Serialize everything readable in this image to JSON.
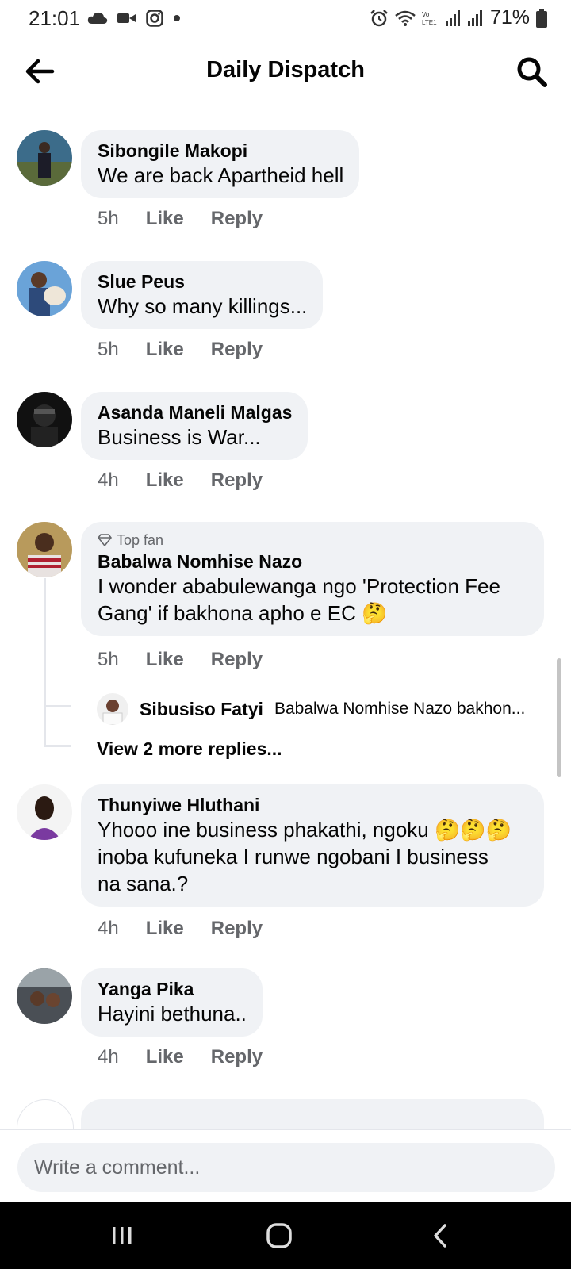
{
  "status_bar": {
    "time": "21:01",
    "battery": "71%",
    "icons": [
      "cloud-icon",
      "video-icon",
      "instagram-icon",
      "dot-icon",
      "alarm-icon",
      "wifi-icon",
      "lte-icon",
      "signal-icon",
      "signal-icon",
      "battery-icon"
    ]
  },
  "header": {
    "title": "Daily Dispatch",
    "back_icon": "back-arrow-icon",
    "search_icon": "search-icon"
  },
  "actions": {
    "like": "Like",
    "reply": "Reply"
  },
  "comments": [
    {
      "author": "Sibongile Makopi",
      "text": "We are back Apartheid hell",
      "time": "5h"
    },
    {
      "author": "Slue Peus",
      "text": "Why so many killings...",
      "time": "5h"
    },
    {
      "author": "Asanda Maneli Malgas",
      "text": "Business is War...",
      "time": "4h"
    },
    {
      "badge": "Top fan",
      "author": "Babalwa Nomhise Nazo",
      "text_line1": "I wonder ababulewanga ngo 'Protection Fee",
      "text_line2": "Gang' if bakhona apho e EC 🤔",
      "time": "5h",
      "reply": {
        "author": "Sibusiso Fatyi",
        "text": "Babalwa Nomhise Nazo bakhon..."
      },
      "more_replies": "View 2 more replies..."
    },
    {
      "author": "Thunyiwe Hluthani",
      "text_line1": "Yhooo ine business phakathi, ngoku 🤔🤔🤔",
      "text_line2": "inoba kufuneka I runwe ngobani I business",
      "text_line3": "na sana.?",
      "time": "4h"
    },
    {
      "author": "Yanga Pika",
      "text": "Hayini bethuna..",
      "time": "4h"
    }
  ],
  "composer": {
    "placeholder": "Write a comment..."
  },
  "colors": {
    "bubble": "#f0f2f5",
    "meta": "#65676b",
    "text": "#050505"
  }
}
